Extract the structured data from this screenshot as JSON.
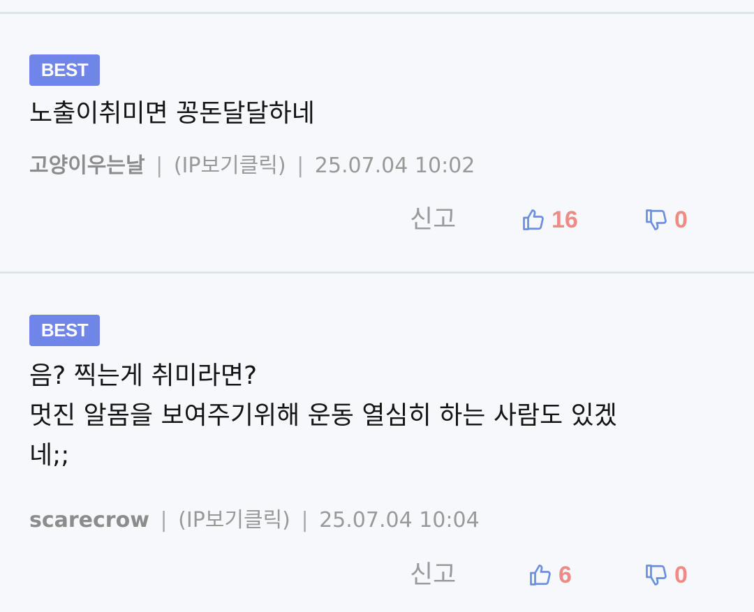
{
  "comments": [
    {
      "badge": "BEST",
      "text": "노출이취미면 꽁돈달달하네",
      "author": "고양이우는날",
      "separator": "|",
      "ip_label": "(IP보기클릭)",
      "timestamp": "25.07.04 10:02",
      "report_label": "신고",
      "like_count": "16",
      "dislike_count": "0"
    },
    {
      "badge": "BEST",
      "text": "음? 찍는게 취미라면?\n멋진 알몸을 보여주기위해 운동 열심히 하는 사람도 있겠\n네;;",
      "author": "scarecrow",
      "separator": "|",
      "ip_label": "(IP보기클릭)",
      "timestamp": "25.07.04 10:04",
      "report_label": "신고",
      "like_count": "6",
      "dislike_count": "0"
    }
  ],
  "icons": {
    "like": "thumbs-up-icon",
    "dislike": "thumbs-down-icon"
  },
  "colors": {
    "badge_bg": "#6f86e8",
    "icon": "#6a8fe0",
    "count": "#f08a85",
    "divider": "#dfe3ea",
    "background": "#f6f8fc"
  }
}
